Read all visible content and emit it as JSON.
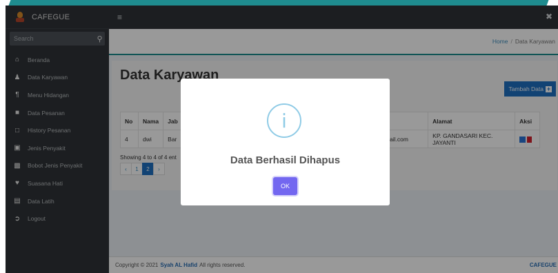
{
  "app": {
    "brand": "CAFEGUE"
  },
  "sidebar": {
    "search_placeholder": "Search",
    "items": [
      {
        "icon": "home-icon",
        "label": "Beranda"
      },
      {
        "icon": "user-icon",
        "label": "Data Karyawan"
      },
      {
        "icon": "utensils-icon",
        "label": "Menu Hidangan"
      },
      {
        "icon": "file-icon",
        "label": "Data Pesanan"
      },
      {
        "icon": "clipboard-icon",
        "label": "History Pesanan"
      },
      {
        "icon": "medkit-icon",
        "label": "Jenis Penyakit"
      },
      {
        "icon": "weight-icon",
        "label": "Bobot Jenis Penyakit"
      },
      {
        "icon": "heart-icon",
        "label": "Suasana Hati"
      },
      {
        "icon": "monitor-icon",
        "label": "Data Latih"
      },
      {
        "icon": "logout-icon",
        "label": "Logout"
      }
    ]
  },
  "breadcrumb": {
    "home": "Home",
    "sep": "/",
    "current": "Data Karyawan"
  },
  "page": {
    "title": "Data Karyawan",
    "add_button": "Tambah Data"
  },
  "table": {
    "headers": {
      "no": "No",
      "nama": "Nama",
      "jab": "Jab",
      "alamat": "Alamat",
      "aksi": "Aksi"
    },
    "rows": [
      {
        "no": "4",
        "nama": "dwi",
        "jab": "Bar",
        "email": "28@gmail.com",
        "alamat": "KP. GANDASARI KEC. JAYANTI"
      }
    ]
  },
  "showing": "Showing 4 to 4 of 4 ent",
  "pagination": [
    "‹",
    "1",
    "2",
    "›"
  ],
  "footer": {
    "prefix": "Copyright © 2021",
    "author": "Syah AL Hafid",
    "suffix": "All rights reserved.",
    "right": "CAFEGUE"
  },
  "dialog": {
    "icon": "info-icon",
    "title": "Data Berhasil Dihapus",
    "ok": "OK"
  },
  "colors": {
    "sidebar_bg": "#2f3337",
    "accent": "#1f70c1",
    "ok_button": "#7367f0",
    "info": "#8fcbe6"
  }
}
